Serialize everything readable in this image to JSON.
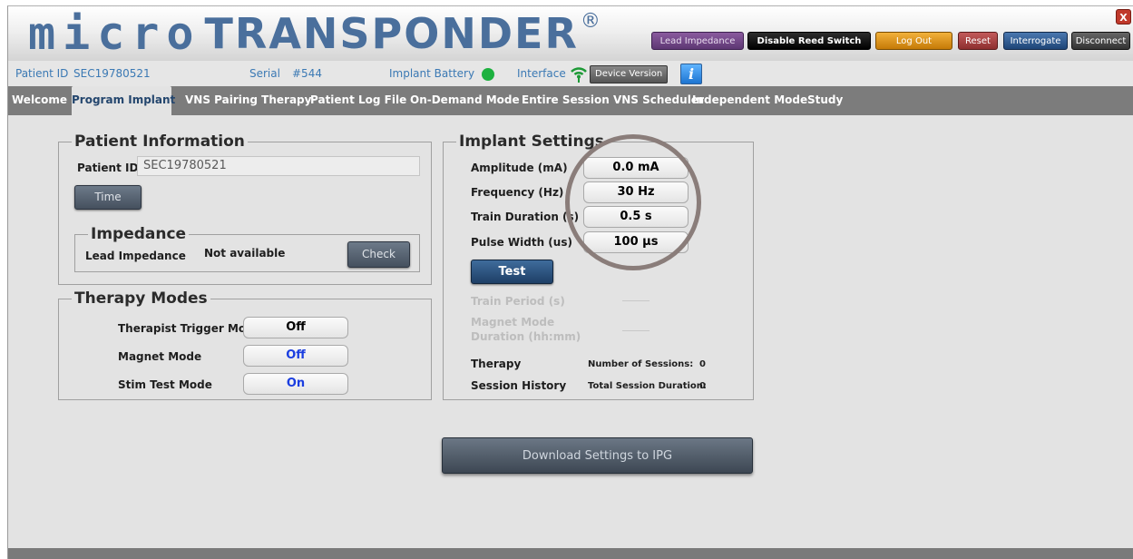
{
  "header": {
    "logo_micro": "micro",
    "logo_trans": "TRANSPONDER",
    "logo_reg": "®",
    "buttons": {
      "lead_impedance": "Lead Impedance",
      "disable_reed_switch": "Disable Reed Switch",
      "log_out": "Log Out",
      "reset": "Reset",
      "interrogate": "Interrogate",
      "disconnect": "Disconnect"
    },
    "close": "X"
  },
  "infobar": {
    "patient_id_label": "Patient ID",
    "patient_id_value": "SEC19780521",
    "serial_label": "Serial",
    "serial_value": "#544",
    "implant_battery_label": "Implant Battery",
    "battery_status_color": "#1db13f",
    "interface_label": "Interface",
    "device_version_button": "Device Version",
    "info_button": "i"
  },
  "tabs": [
    "Welcome",
    "Program Implant",
    "VNS Pairing Therapy",
    "Patient Log File",
    "On-Demand Mode",
    "Entire Session VNS Scheduler",
    "Independent Mode",
    "Study"
  ],
  "patient_info": {
    "legend": "Patient Information",
    "patient_id_label": "Patient ID:",
    "patient_id_value": "SEC19780521",
    "time_button": "Time"
  },
  "impedance": {
    "legend": "Impedance",
    "lead_impedance_label": "Lead Impedance",
    "lead_impedance_value": "Not available",
    "check_button": "Check"
  },
  "therapy_modes": {
    "legend": "Therapy Modes",
    "therapist_trigger_label": "Therapist Trigger Mode",
    "therapist_trigger_value": "Off",
    "magnet_mode_label": "Magnet Mode",
    "magnet_mode_value": "Off",
    "stim_test_label": "Stim Test Mode",
    "stim_test_value": "On"
  },
  "implant_settings": {
    "legend": "Implant Settings",
    "amplitude_label": "Amplitude (mA)",
    "amplitude_value": "0.0 mA",
    "frequency_label": "Frequency (Hz)",
    "frequency_value": "30 Hz",
    "train_duration_label": "Train Duration (s)",
    "train_duration_value": "0.5 s",
    "pulse_width_label": "Pulse Width (us)",
    "pulse_width_value": "100 µs",
    "test_button": "Test",
    "train_period_label": "Train Period (s)",
    "magnet_mode_duration_label_1": "Magnet Mode",
    "magnet_mode_duration_label_2": "Duration (hh:mm)",
    "therapy_label": "Therapy",
    "session_history_label": "Session History",
    "number_of_sessions_label": "Number of Sessions:",
    "number_of_sessions_value": "0",
    "total_session_duration_label": "Total Session Duration:",
    "total_session_duration_value": "0"
  },
  "download_button": "Download Settings to IPG",
  "colors": {
    "brand_blue": "#4a6f9c",
    "tab_bar": "#7c7c7c",
    "on_off_blue": "#1b3ee0",
    "annotation_circle": "#8a7d7a"
  }
}
